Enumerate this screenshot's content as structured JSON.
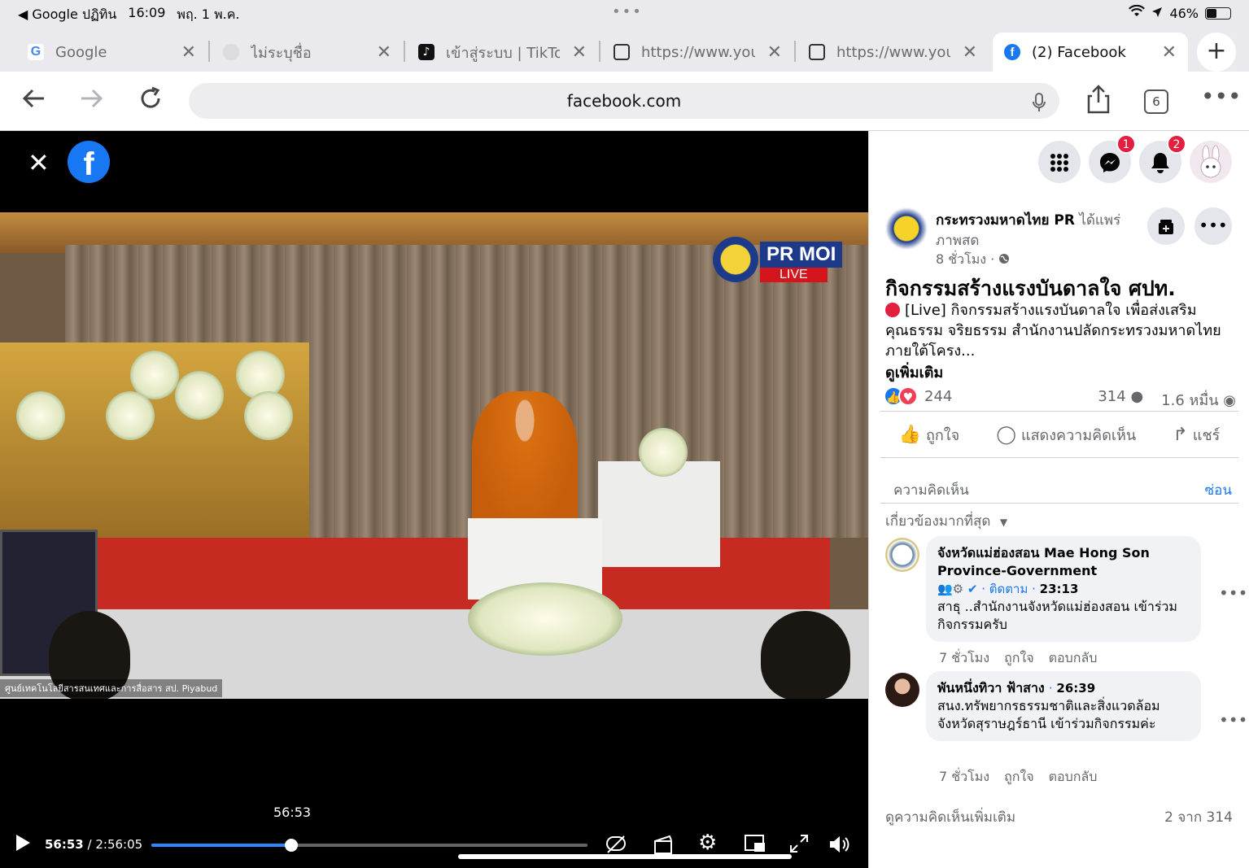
{
  "status_bar": {
    "back_app": "◀ Google ปฏิทิน",
    "time": "16:09",
    "date": "พฤ. 1 พ.ค.",
    "dots": "•••",
    "battery": "46%",
    "battery_level": 0.46
  },
  "tabs": [
    {
      "label": "Google",
      "icon": "google-icon",
      "icon_color": "#ffffff"
    },
    {
      "label": "ไม่ระบุชื่อ",
      "icon": "globe-icon",
      "icon_color": "#dcdce0"
    },
    {
      "label": "เข้าสู่ระบบ | TikTok",
      "icon": "tiktok-icon",
      "icon_color": "#111111"
    },
    {
      "label": "https://www.youtube",
      "icon": "page-icon",
      "icon_color": "#ffffff"
    },
    {
      "label": "https://www.youtube",
      "icon": "page-icon",
      "icon_color": "#ffffff"
    },
    {
      "label": "(2) Facebook",
      "icon": "facebook-icon",
      "icon_color": "#1877f2",
      "active": true
    }
  ],
  "tab_close_glyph": "✕",
  "new_tab_glyph": "+",
  "url_bar": {
    "url": "facebook.com",
    "tab_count": "6"
  },
  "video": {
    "overlay_logo_text": "PR MOI",
    "overlay_live": "LIVE",
    "caption": "ศูนย์เทคโนโลยีสารสนเทศและการสื่อสาร สป. Piyabud",
    "hover_time": "56:53",
    "current_time": "56:53",
    "duration": "2:56:05",
    "progress_fraction": 0.3212
  },
  "panel": {
    "messenger_badge": "1",
    "notifications_badge": "2",
    "page_name": "กระทรวงมหาดไทย PR",
    "shared_text": "ได้แพร่ภาพสด",
    "post_time": "8 ชั่วโมง ·",
    "post_title": "กิจกรรมสร้างแรงบันดาลใจ ศปท.",
    "post_body": "[Live] กิจกรรมสร้างแรงบันดาลใจ เพื่อส่งเสริมคุณธรรม จริยธรรม สำนักงานปลัดกระทรวงมหาดไทย ภายใต้โครง...",
    "see_more": "ดูเพิ่มเติม",
    "reaction_count": "244",
    "comment_count": "314",
    "view_count": "1.6 หมื่น",
    "action_like": "ถูกใจ",
    "action_comment": "แสดงความคิดเห็น",
    "action_share": "แชร์",
    "comments_label": "ความคิดเห็น",
    "hide_label": "ซ่อน",
    "sort_label": "เกี่ยวข้องมากที่สุด",
    "comments": [
      {
        "author": "จังหวัดแม่ฮ่องสอน Mae Hong Son Province-Government",
        "follow": "· ติดตาม ·",
        "timestamp": "23:13",
        "text": "สาธุ ..สำนักงานจังหวัดแม่ฮ่องสอน เข้าร่วมกิจกรรมครับ",
        "age": "7 ชั่วโมง",
        "like": "ถูกใจ",
        "reply": "ตอบกลับ"
      },
      {
        "author": "พันหนึ่งทิวา ฟ้าสาง",
        "follow": "·",
        "timestamp": "26:39",
        "text": "สนง.ทรัพยากรธรรมชาติและสิ่งแวดล้อมจังหวัดสุราษฎร์ธานี เข้าร่วมกิจกรรมค่ะ",
        "age": "7 ชั่วโมง",
        "like": "ถูกใจ",
        "reply": "ตอบกลับ"
      }
    ],
    "more_comments": "ดูความคิดเห็นเพิ่มเติม",
    "pager": "2 จาก 314"
  }
}
